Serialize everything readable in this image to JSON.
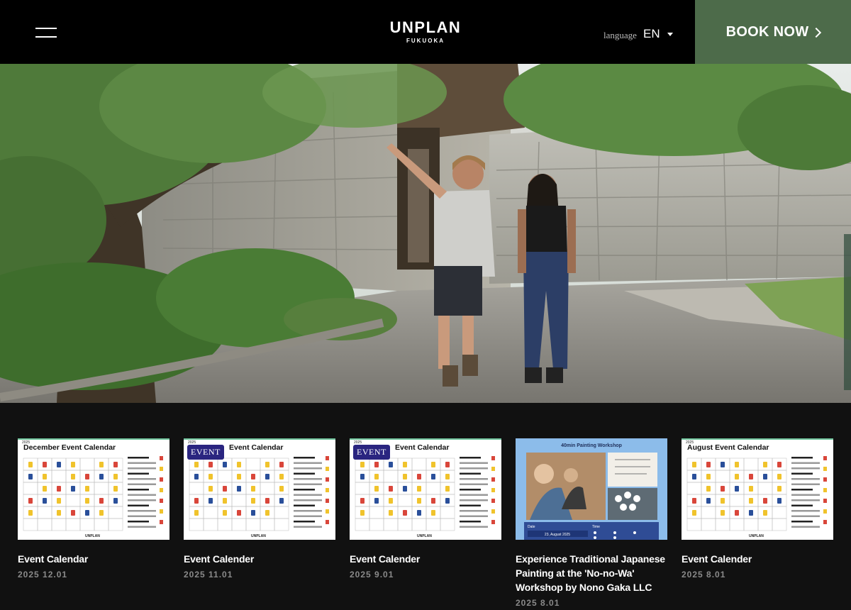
{
  "header": {
    "logo_main": "UNPLAN",
    "logo_sub": "FUKUOKA",
    "language_label": "language",
    "language_value": "EN",
    "book_label": "BOOK NOW",
    "book_color": "#4d6b4a"
  },
  "icons": {
    "menu": "hamburger-menu-icon",
    "language": "caret-down-icon",
    "book": "chevron-right-icon"
  },
  "cards": [
    {
      "title": "Event Calendar",
      "date": "2025 12.01",
      "badge": "",
      "thumb_heading": "December Event Calendar",
      "thumb_year": "2025",
      "thumb_footer": "UNPLAN"
    },
    {
      "title": "Event Calender",
      "date": "2025 11.01",
      "badge": "EVENT",
      "thumb_heading": "Event Calendar",
      "thumb_year": "2025",
      "thumb_footer": "UNPLAN"
    },
    {
      "title": "Event Calender",
      "date": "2025 9.01",
      "badge": "EVENT",
      "thumb_heading": "Event Calendar",
      "thumb_year": "2025",
      "thumb_footer": "UNPLAN"
    },
    {
      "title": "Experience Traditional Japanese Painting at the 'No-no-Wa' Workshop by Nono Gaka LLC",
      "date": "2025 8.01",
      "badge": "",
      "thumb_heading": "40min Painting Workshop",
      "thumb_date_label": "Date",
      "thumb_date_value": "23, August 2025",
      "thumb_time_label": "Time"
    },
    {
      "title": "Event Calender",
      "date": "2025 8.01",
      "badge": "",
      "thumb_heading": "August Event Calendar",
      "thumb_year": "2025",
      "thumb_footer": "UNPLAN"
    }
  ]
}
